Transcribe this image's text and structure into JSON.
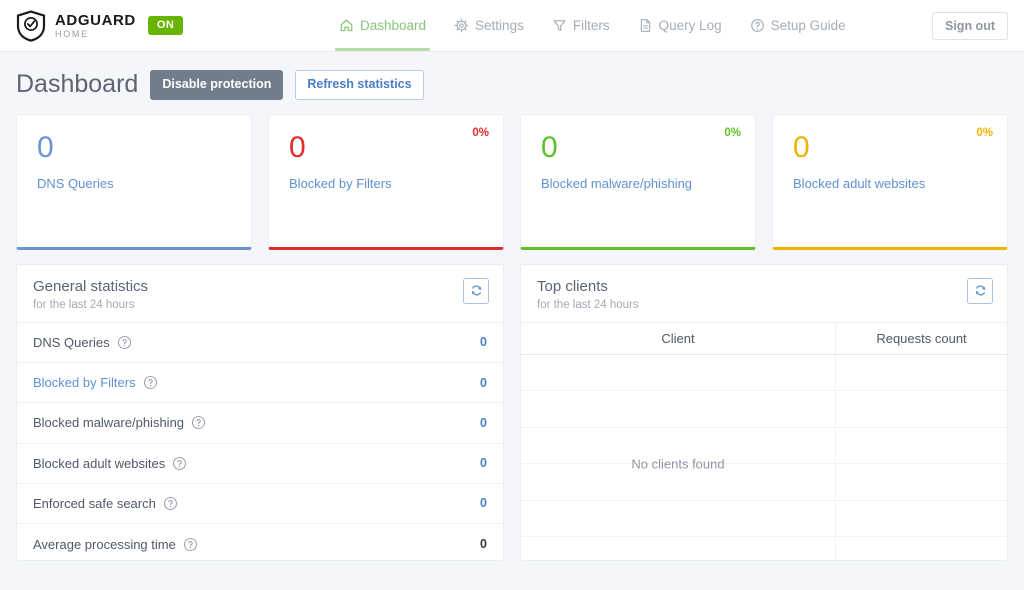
{
  "header": {
    "brand_title": "ADGUARD",
    "brand_sub": "HOME",
    "status_badge": "ON",
    "signout_label": "Sign out",
    "nav": [
      {
        "label": "Dashboard",
        "icon": "home-icon",
        "active": true
      },
      {
        "label": "Settings",
        "icon": "gear-icon",
        "active": false
      },
      {
        "label": "Filters",
        "icon": "funnel-icon",
        "active": false
      },
      {
        "label": "Query Log",
        "icon": "document-icon",
        "active": false
      },
      {
        "label": "Setup Guide",
        "icon": "question-circle-icon",
        "active": false
      }
    ]
  },
  "page": {
    "title": "Dashboard",
    "disable_protection_label": "Disable protection",
    "refresh_statistics_label": "Refresh statistics"
  },
  "cards": [
    {
      "value": "0",
      "label": "DNS Queries",
      "percent": "",
      "color": "#6a93d4"
    },
    {
      "value": "0",
      "label": "Blocked by Filters",
      "percent": "0%",
      "color": "#e02c2c"
    },
    {
      "value": "0",
      "label": "Blocked malware/phishing",
      "percent": "0%",
      "color": "#5ec12a"
    },
    {
      "value": "0",
      "label": "Blocked adult websites",
      "percent": "0%",
      "color": "#f0b400"
    }
  ],
  "general_statistics": {
    "title": "General statistics",
    "subtitle": "for the last 24 hours",
    "refresh_icon": "refresh-icon",
    "rows": [
      {
        "label": "DNS Queries",
        "value": "0",
        "link": false,
        "dark_value": false
      },
      {
        "label": "Blocked by Filters",
        "value": "0",
        "link": true,
        "dark_value": false
      },
      {
        "label": "Blocked malware/phishing",
        "value": "0",
        "link": false,
        "dark_value": false
      },
      {
        "label": "Blocked adult websites",
        "value": "0",
        "link": false,
        "dark_value": false
      },
      {
        "label": "Enforced safe search",
        "value": "0",
        "link": false,
        "dark_value": false
      },
      {
        "label": "Average processing time",
        "value": "0",
        "link": false,
        "dark_value": true
      }
    ]
  },
  "top_clients": {
    "title": "Top clients",
    "subtitle": "for the last 24 hours",
    "refresh_icon": "refresh-icon",
    "columns": [
      "Client",
      "Requests count"
    ],
    "rows": [],
    "empty_message": "No clients found"
  }
}
